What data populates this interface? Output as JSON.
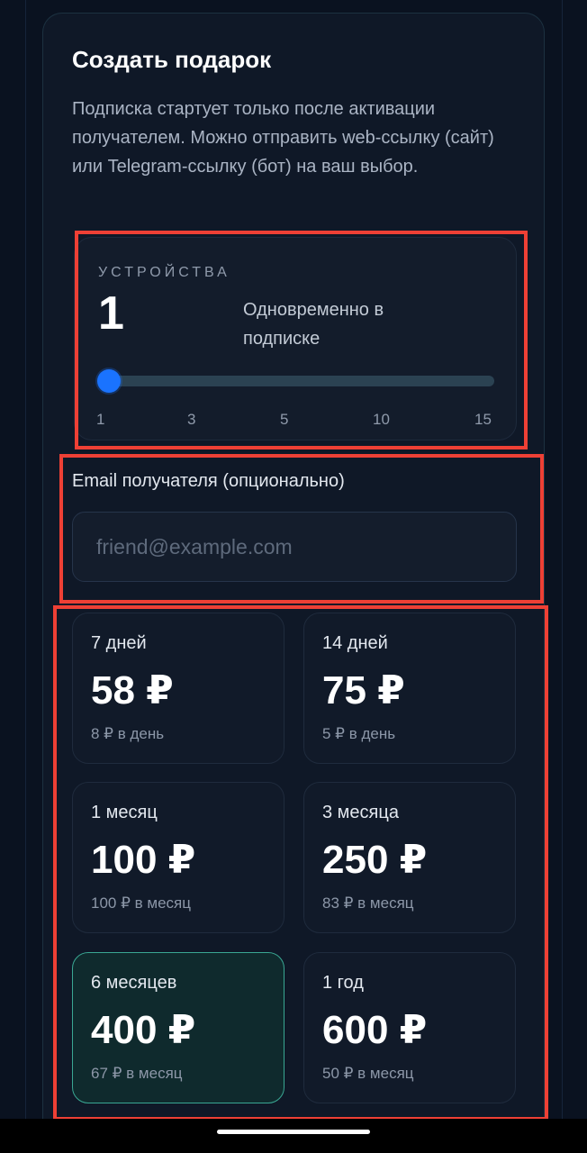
{
  "gift": {
    "title": "Создать подарок",
    "description": "Подписка стартует только после активации получателем. Можно отправить web-ссылку (сайт) или Telegram-ссылку (бот) на ваш выбор."
  },
  "devices": {
    "label": "УСТРОЙСТВА",
    "value": "1",
    "note": "Одновременно в подписке",
    "slider_min": 1,
    "slider_max": 15,
    "slider_value": 1,
    "ticks": [
      "1",
      "3",
      "5",
      "10",
      "15"
    ]
  },
  "email": {
    "label": "Email получателя (опционально)",
    "placeholder": "friend@example.com",
    "value": ""
  },
  "plans": [
    {
      "period": "7 дней",
      "price": "58 ₽",
      "rate": "8 ₽ в день",
      "selected": false
    },
    {
      "period": "14 дней",
      "price": "75 ₽",
      "rate": "5 ₽ в день",
      "selected": false
    },
    {
      "period": "1 месяц",
      "price": "100 ₽",
      "rate": "100 ₽ в месяц",
      "selected": false
    },
    {
      "period": "3 месяца",
      "price": "250 ₽",
      "rate": "83 ₽ в месяц",
      "selected": false
    },
    {
      "period": "6 месяцев",
      "price": "400 ₽",
      "rate": "67 ₽ в месяц",
      "selected": true
    },
    {
      "period": "1 год",
      "price": "600 ₽",
      "rate": "50 ₽ в месяц",
      "selected": false
    }
  ],
  "colors": {
    "background": "#0a1220",
    "accent": "#1a73ff",
    "selected_border": "#3aa793",
    "highlight": "#ee4035"
  }
}
